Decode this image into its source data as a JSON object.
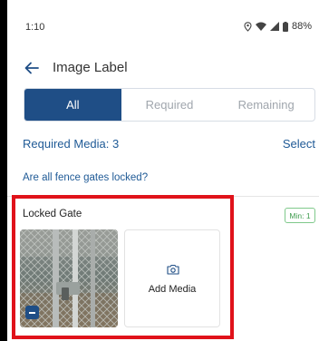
{
  "status_bar": {
    "time": "1:10",
    "battery_percent": "88%",
    "icons": [
      "location-icon",
      "wifi-icon",
      "signal-icon",
      "battery-icon"
    ]
  },
  "app_bar": {
    "title": "Image Label",
    "back_icon": "arrow-left-icon"
  },
  "tabs": [
    {
      "label": "All",
      "active": true
    },
    {
      "label": "Required",
      "active": false
    },
    {
      "label": "Remaining",
      "active": false
    }
  ],
  "required_media_label": "Required Media: 3",
  "select_label": "Select",
  "question": "Are all fence gates locked?",
  "item": {
    "title": "Locked Gate",
    "min_badge": "Min: 1",
    "add_media_label": "Add Media",
    "camera_icon": "camera-icon",
    "remove_icon": "minus-icon"
  },
  "colors": {
    "accent": "#1f4e86",
    "link": "#1f5a96",
    "highlight": "#e0121a",
    "badge_green": "#3f9c4e"
  }
}
